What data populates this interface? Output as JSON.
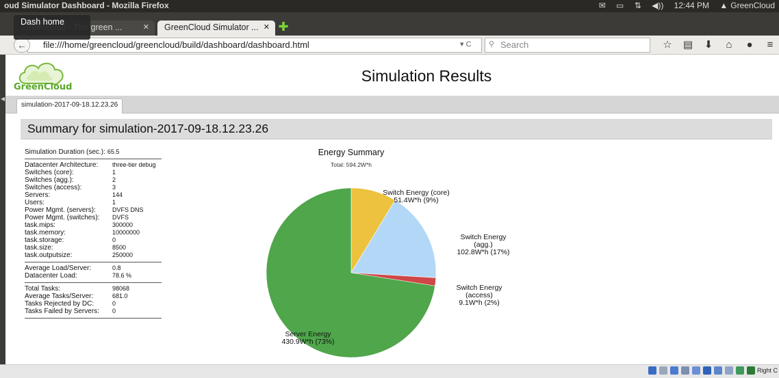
{
  "os": {
    "window_title": "oud Simulator Dashboard - Mozilla Firefox",
    "clock": "12:44 PM",
    "user": "GreenCloud"
  },
  "browser": {
    "tabs": [
      {
        "label": "Greencloud - The green ..."
      },
      {
        "label": "GreenCloud Simulator ..."
      }
    ],
    "tooltip": "Dash home",
    "url": "file:///home/greencloud/greencloud/build/dashboard/dashboard.html",
    "search_placeholder": "Search"
  },
  "page": {
    "logo_text": "GreenCloud",
    "title": "Simulation Results",
    "result_tab": "simulation-2017-09-18.12.23.26",
    "summary_header": "Summary for simulation-2017-09-18.12.23.26"
  },
  "stats": {
    "duration": {
      "label": "Simulation Duration (sec.):",
      "value": "65.5"
    },
    "config": [
      {
        "label": "Datacenter Architecture:",
        "value": "three-tier debug"
      },
      {
        "label": "Switches (core):",
        "value": "1"
      },
      {
        "label": "Switches (agg.):",
        "value": "2"
      },
      {
        "label": "Switches (access):",
        "value": "3"
      },
      {
        "label": "Servers:",
        "value": "144"
      },
      {
        "label": "Users:",
        "value": "1"
      },
      {
        "label": "Power Mgmt. (servers):",
        "value": "DVFS DNS"
      },
      {
        "label": "Power Mgmt. (switches):",
        "value": "DVFS"
      },
      {
        "label": "task.mips:",
        "value": "300000"
      },
      {
        "label": "task.memory:",
        "value": "10000000"
      },
      {
        "label": "task.storage:",
        "value": "0"
      },
      {
        "label": "task.size:",
        "value": "8500"
      },
      {
        "label": "task.outputsize:",
        "value": "250000"
      }
    ],
    "load": [
      {
        "label": "Average Load/Server:",
        "value": "0.8"
      },
      {
        "label": "Datacenter Load:",
        "value": "78.6 %"
      }
    ],
    "tasks": [
      {
        "label": "Total Tasks:",
        "value": "98068"
      },
      {
        "label": "Average Tasks/Server:",
        "value": "681.0"
      },
      {
        "label": "Tasks Rejected by DC:",
        "value": "0"
      },
      {
        "label": "Tasks Failed by Servers:",
        "value": "0"
      }
    ]
  },
  "chart_data": {
    "type": "pie",
    "title": "Energy Summary",
    "subtitle": "Total: 594.2W*h",
    "slices": [
      {
        "name": "Switch Energy (core)",
        "value": 51.4,
        "percent": 9,
        "color": "#ecc23e",
        "label_lines": [
          "Switch Energy (core)",
          "51.4W*h (9%)"
        ]
      },
      {
        "name": "Switch Energy (agg.)",
        "value": 102.8,
        "percent": 17,
        "color": "#b3d8f7",
        "label_lines": [
          "Switch Energy",
          "(agg.)",
          "102.8W*h (17%)"
        ]
      },
      {
        "name": "Switch Energy (access)",
        "value": 9.1,
        "percent": 2,
        "color": "#cf4747",
        "label_lines": [
          "Switch Energy",
          "(access)",
          "9.1W*h (2%)"
        ]
      },
      {
        "name": "Server Energy",
        "value": 430.9,
        "percent": 73,
        "color": "#4fa64b",
        "label_lines": [
          "Server Energy",
          "430.9W*h (73%)"
        ]
      }
    ]
  },
  "statusbar": {
    "right_ctrl": "Right C"
  }
}
